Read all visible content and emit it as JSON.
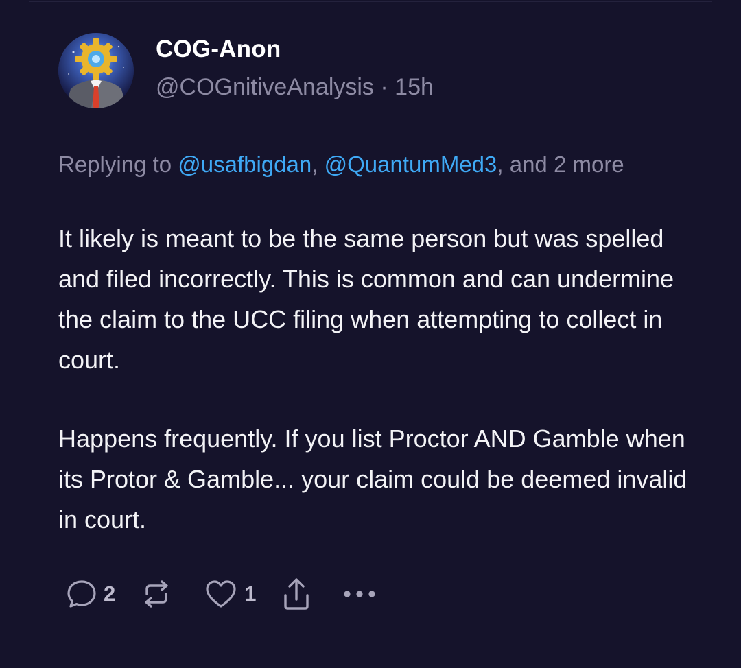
{
  "post": {
    "author": {
      "display_name": "COG-Anon",
      "handle": "@COGnitiveAnalysis",
      "separator": "·",
      "time": "15h"
    },
    "reply": {
      "prefix": "Replying to ",
      "mentions": [
        "@usafbigdan",
        "@QuantumMed3"
      ],
      "comma": ", ",
      "suffix": ", and 2 more"
    },
    "paragraphs": [
      "It likely is meant to be the same person but was spelled and filed incorrectly. This is common and can undermine the claim to the UCC filing when attempting to collect in court.",
      "Happens frequently. If you list Proctor AND Gamble when its Protor & Gamble... your claim could be deemed invalid in court."
    ],
    "actions": {
      "reply_icon": "speech-bubble-icon",
      "reply_count": "2",
      "repost_icon": "repost-arrows-icon",
      "like_icon": "heart-icon",
      "like_count": "1",
      "share_icon": "share-upload-icon",
      "more_icon": "ellipsis-icon"
    }
  },
  "colors": {
    "background": "#15132b",
    "mention": "#3fa9f5",
    "muted_text": "#8d8aa3",
    "primary_text": "#f3f3f6",
    "gear": "#e9b52c",
    "tie": "#d9402b"
  }
}
